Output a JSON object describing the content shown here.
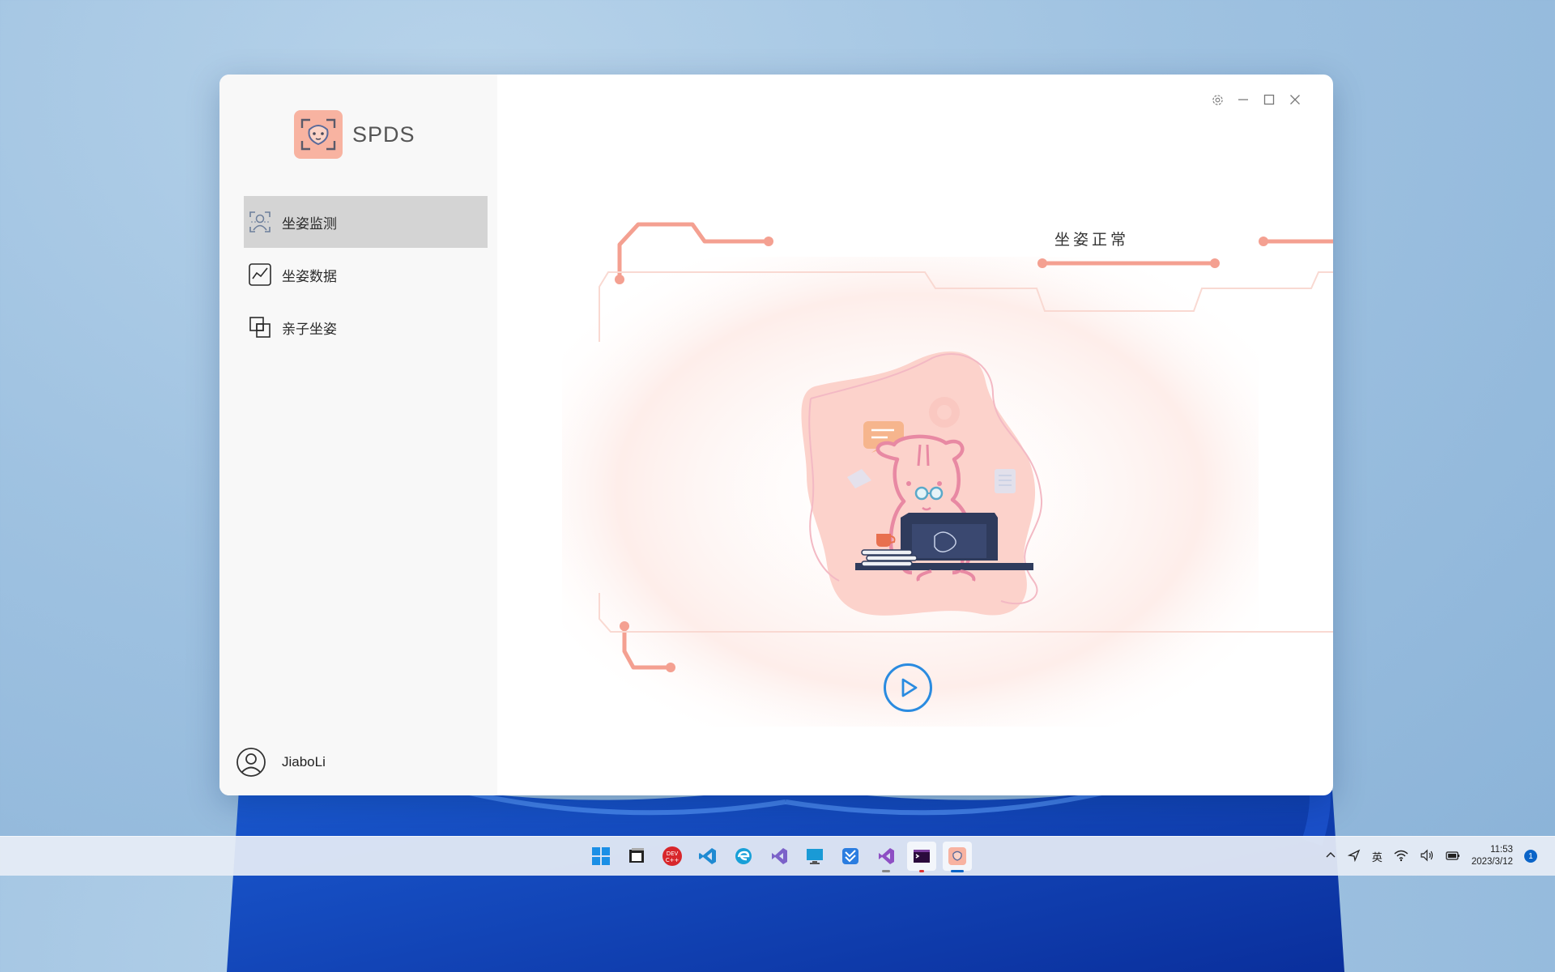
{
  "app": {
    "title": "SPDS",
    "logo_icon": "hamster-face-icon"
  },
  "sidebar": {
    "items": [
      {
        "label": "坐姿监测",
        "icon": "posture-monitor-icon",
        "active": true
      },
      {
        "label": "坐姿数据",
        "icon": "line-chart-icon",
        "active": false
      },
      {
        "label": "亲子坐姿",
        "icon": "parent-child-icon",
        "active": false
      }
    ]
  },
  "user": {
    "name": "JiaboLi",
    "icon": "user-circle-icon"
  },
  "window_controls": [
    "settings-icon",
    "minimize-icon",
    "maximize-icon",
    "close-icon"
  ],
  "main": {
    "status": "坐姿正常",
    "play_icon": "play-icon"
  },
  "colors": {
    "accent_frame": "#f4a091",
    "sidebar_bg": "#f8f8f8",
    "active_nav_bg": "#d4d4d4",
    "play_blue": "#2a8be0",
    "logo_bg": "#f8b3a1"
  },
  "taskbar": {
    "apps": [
      "windows-start-icon",
      "file-explorer-icon",
      "dev-cpp-icon",
      "vscode-icon",
      "edge-icon",
      "visual-studio-icon",
      "remote-desktop-icon",
      "kanban-icon",
      "visual-studio-preview-icon",
      "terminal-icon",
      "spds-app-icon"
    ],
    "tray": {
      "ime": "英",
      "time": "11:53",
      "date": "2023/3/12",
      "notifications": "1"
    }
  }
}
